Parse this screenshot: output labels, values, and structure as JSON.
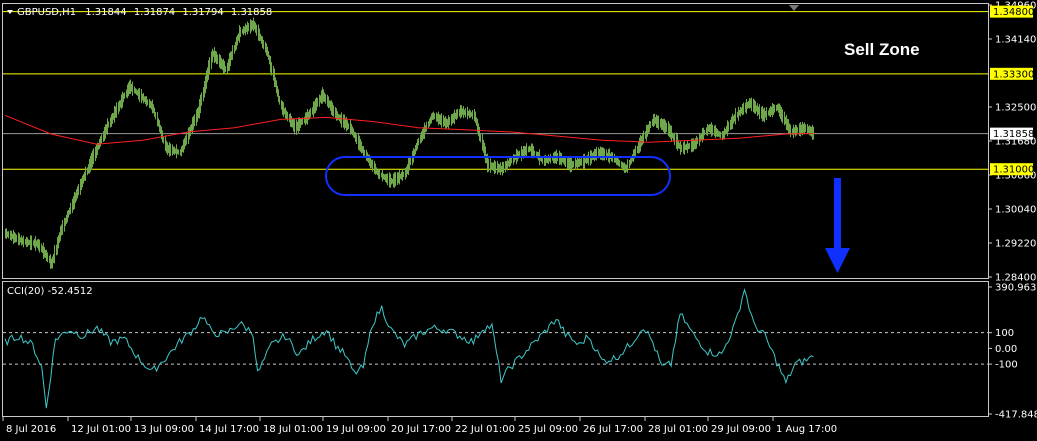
{
  "header": {
    "symbol": "GBPUSD,H1",
    "open": "1.31844",
    "high": "1.31874",
    "low": "1.31794",
    "close": "1.31858"
  },
  "annotation": {
    "sell_zone": "Sell Zone"
  },
  "price_axis": {
    "ticks": [
      "1.34960",
      "1.34140",
      "1.32500",
      "1.31680",
      "1.30860",
      "1.30040",
      "1.29220",
      "1.28400"
    ],
    "current_price": "1.31858"
  },
  "horizontal_levels": [
    {
      "label": "1.34800",
      "value": 1.348,
      "color": "#ffff00"
    },
    {
      "label": "1.33300",
      "value": 1.333,
      "color": "#ffff00"
    },
    {
      "label": "1.31000",
      "value": 1.31,
      "color": "#ffff00"
    }
  ],
  "cci_panel": {
    "label": "CCI(20) -52.4512",
    "ticks": [
      "390.963",
      "100",
      "0.00",
      "-100",
      "-417.8481"
    ],
    "levels": [
      100,
      -100
    ],
    "range": [
      -417.8481,
      390.963
    ]
  },
  "time_axis": {
    "labels": [
      "8 Jul 2016",
      "12 Jul 01:00",
      "13 Jul 09:00",
      "14 Jul 17:00",
      "18 Jul 01:00",
      "19 Jul 09:00",
      "20 Jul 17:00",
      "22 Jul 01:00",
      "25 Jul 09:00",
      "26 Jul 17:00",
      "28 Jul 01:00",
      "29 Jul 09:00",
      "1 Aug 17:00"
    ]
  },
  "colors": {
    "background": "#000000",
    "bars": "#6fa84a",
    "moving_average": "#ff2020",
    "cci_line": "#3fc8c8",
    "level_line": "#ffff00",
    "highlight_ellipse": "#1030ff",
    "arrow": "#1030ff",
    "grid": "#c8c8c8"
  },
  "chart_data": [
    {
      "type": "bar",
      "title": "GBPUSD,H1",
      "ylim": [
        1.284,
        1.3496
      ],
      "x_labels": [
        "8 Jul 2016",
        "12 Jul 01:00",
        "13 Jul 09:00",
        "14 Jul 17:00",
        "18 Jul 01:00",
        "19 Jul 09:00",
        "20 Jul 17:00",
        "22 Jul 01:00",
        "25 Jul 09:00",
        "26 Jul 17:00",
        "28 Jul 01:00",
        "29 Jul 09:00",
        "1 Aug 17:00"
      ],
      "close_path": [
        [
          0,
          1.2945
        ],
        [
          4,
          1.2925
        ],
        [
          7,
          1.292
        ],
        [
          9,
          1.289
        ],
        [
          10,
          1.287
        ],
        [
          12,
          1.295
        ],
        [
          17,
          1.308
        ],
        [
          22,
          1.32
        ],
        [
          27,
          1.33
        ],
        [
          32,
          1.325
        ],
        [
          35,
          1.315
        ],
        [
          38,
          1.314
        ],
        [
          42,
          1.324
        ],
        [
          45,
          1.338
        ],
        [
          48,
          1.334
        ],
        [
          51,
          1.343
        ],
        [
          54,
          1.345
        ],
        [
          57,
          1.338
        ],
        [
          60,
          1.325
        ],
        [
          63,
          1.32
        ],
        [
          66,
          1.323
        ],
        [
          69,
          1.328
        ],
        [
          72,
          1.323
        ],
        [
          75,
          1.32
        ],
        [
          78,
          1.314
        ],
        [
          81,
          1.309
        ],
        [
          84,
          1.307
        ],
        [
          87,
          1.309
        ],
        [
          90,
          1.317
        ],
        [
          93,
          1.323
        ],
        [
          96,
          1.321
        ],
        [
          99,
          1.324
        ],
        [
          102,
          1.323
        ],
        [
          105,
          1.311
        ],
        [
          108,
          1.31
        ],
        [
          111,
          1.313
        ],
        [
          114,
          1.315
        ],
        [
          117,
          1.312
        ],
        [
          120,
          1.313
        ],
        [
          123,
          1.311
        ],
        [
          126,
          1.312
        ],
        [
          129,
          1.314
        ],
        [
          132,
          1.313
        ],
        [
          135,
          1.31
        ],
        [
          138,
          1.316
        ],
        [
          141,
          1.322
        ],
        [
          144,
          1.32
        ],
        [
          147,
          1.315
        ],
        [
          150,
          1.316
        ],
        [
          153,
          1.32
        ],
        [
          156,
          1.318
        ],
        [
          159,
          1.323
        ],
        [
          162,
          1.326
        ],
        [
          165,
          1.323
        ],
        [
          168,
          1.325
        ],
        [
          171,
          1.319
        ],
        [
          174,
          1.32
        ],
        [
          176,
          1.3186
        ]
      ],
      "moving_average": [
        [
          0,
          1.323
        ],
        [
          10,
          1.3185
        ],
        [
          20,
          1.316
        ],
        [
          30,
          1.317
        ],
        [
          40,
          1.319
        ],
        [
          50,
          1.32
        ],
        [
          60,
          1.322
        ],
        [
          70,
          1.3225
        ],
        [
          80,
          1.3215
        ],
        [
          90,
          1.32
        ],
        [
          100,
          1.3195
        ],
        [
          110,
          1.319
        ],
        [
          120,
          1.318
        ],
        [
          130,
          1.317
        ],
        [
          140,
          1.3165
        ],
        [
          150,
          1.317
        ],
        [
          160,
          1.3175
        ],
        [
          170,
          1.3185
        ],
        [
          176,
          1.3186
        ]
      ],
      "levels": [
        1.348,
        1.333,
        1.31
      ]
    },
    {
      "type": "line",
      "title": "CCI(20) -52.4512",
      "ylim": [
        -417.8481,
        390.963
      ],
      "series": [
        {
          "values": [
            [
              0,
              40
            ],
            [
              3,
              80
            ],
            [
              6,
              20
            ],
            [
              8,
              -120
            ],
            [
              9,
              -380
            ],
            [
              11,
              60
            ],
            [
              14,
              120
            ],
            [
              17,
              80
            ],
            [
              20,
              130
            ],
            [
              23,
              40
            ],
            [
              26,
              60
            ],
            [
              29,
              -60
            ],
            [
              32,
              -150
            ],
            [
              35,
              -60
            ],
            [
              38,
              40
            ],
            [
              41,
              120
            ],
            [
              43,
              210
            ],
            [
              45,
              100
            ],
            [
              48,
              90
            ],
            [
              51,
              160
            ],
            [
              54,
              100
            ],
            [
              55,
              -160
            ],
            [
              58,
              20
            ],
            [
              61,
              80
            ],
            [
              64,
              -40
            ],
            [
              67,
              60
            ],
            [
              70,
              120
            ],
            [
              72,
              20
            ],
            [
              74,
              -40
            ],
            [
              76,
              -160
            ],
            [
              78,
              -120
            ],
            [
              80,
              160
            ],
            [
              82,
              260
            ],
            [
              84,
              120
            ],
            [
              87,
              20
            ],
            [
              90,
              90
            ],
            [
              93,
              130
            ],
            [
              96,
              120
            ],
            [
              99,
              80
            ],
            [
              102,
              40
            ],
            [
              104,
              130
            ],
            [
              106,
              140
            ],
            [
              108,
              -200
            ],
            [
              110,
              -120
            ],
            [
              112,
              -60
            ],
            [
              115,
              30
            ],
            [
              118,
              120
            ],
            [
              120,
              190
            ],
            [
              122,
              90
            ],
            [
              125,
              20
            ],
            [
              127,
              80
            ],
            [
              130,
              -80
            ],
            [
              133,
              -60
            ],
            [
              136,
              20
            ],
            [
              139,
              140
            ],
            [
              141,
              40
            ],
            [
              143,
              -120
            ],
            [
              145,
              -100
            ],
            [
              147,
              220
            ],
            [
              150,
              80
            ],
            [
              153,
              -20
            ],
            [
              156,
              -40
            ],
            [
              159,
              160
            ],
            [
              161,
              380
            ],
            [
              163,
              150
            ],
            [
              165,
              100
            ],
            [
              167,
              -20
            ],
            [
              170,
              -220
            ],
            [
              172,
              -100
            ],
            [
              174,
              -80
            ],
            [
              176,
              -52.45
            ]
          ]
        }
      ],
      "levels": [
        100,
        -100
      ]
    }
  ]
}
